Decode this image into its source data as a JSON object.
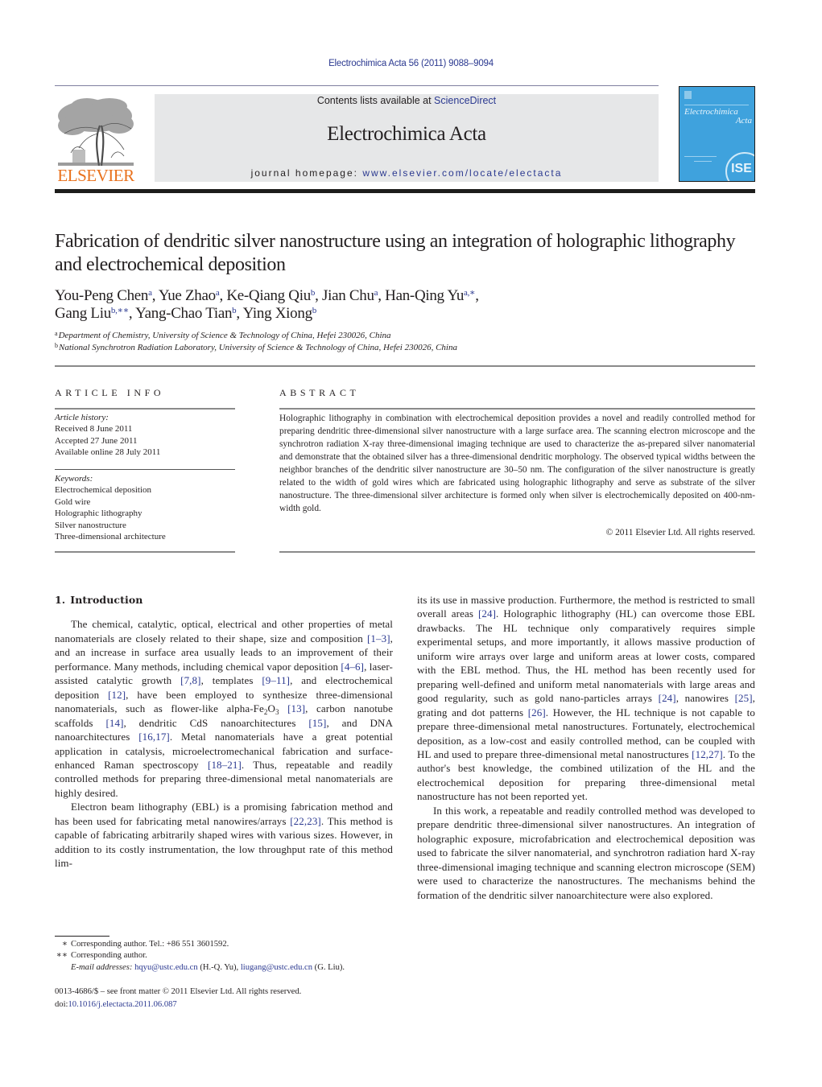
{
  "header": {
    "running_head": "Electrochimica Acta 56 (2011) 9088–9094",
    "contents_prefix": "Contents lists available at ",
    "contents_link": "ScienceDirect",
    "journal_name": "Electrochimica Acta",
    "homepage_prefix": "journal homepage: ",
    "homepage_url": "www.elsevier.com/locate/electacta",
    "publisher_logo_text": "ELSEVIER",
    "cover": {
      "title_line1": "Electrochimica",
      "title_line2": "Acta",
      "seal_text": "ISE",
      "background": "#3fa2dd"
    },
    "link_color": "#2b3990",
    "publisher_color": "#e9711c"
  },
  "article": {
    "title": "Fabrication of dendritic silver nanostructure using an integration of holographic lithography and electrochemical deposition",
    "authors_line1": [
      {
        "name": "You-Peng Chen",
        "sup": "a",
        "sep": ", "
      },
      {
        "name": "Yue Zhao",
        "sup": "a",
        "sep": ", "
      },
      {
        "name": "Ke-Qiang Qiu",
        "sup": "b",
        "sep": ", "
      },
      {
        "name": "Jian Chu",
        "sup": "a",
        "sep": ", "
      },
      {
        "name": "Han-Qing Yu",
        "sup": "a,∗",
        "sep": ","
      }
    ],
    "authors_line2": [
      {
        "name": "Gang Liu",
        "sup": "b,∗∗",
        "sep": ", "
      },
      {
        "name": "Yang-Chao Tian",
        "sup": "b",
        "sep": ", "
      },
      {
        "name": "Ying Xiong",
        "sup": "b",
        "sep": ""
      }
    ],
    "affiliations": [
      {
        "mark": "a",
        "text": "Department of Chemistry, University of Science & Technology of China, Hefei 230026, China"
      },
      {
        "mark": "b",
        "text": "National Synchrotron Radiation Laboratory, University of Science & Technology of China, Hefei 230026, China"
      }
    ]
  },
  "article_info": {
    "heading": "ARTICLE INFO",
    "history_label": "Article history:",
    "received": "Received 8 June 2011",
    "accepted": "Accepted 27 June 2011",
    "online": "Available online 28 July 2011",
    "keywords_label": "Keywords:",
    "keywords": [
      "Electrochemical deposition",
      "Gold wire",
      "Holographic lithography",
      "Silver nanostructure",
      "Three-dimensional architecture"
    ]
  },
  "abstract": {
    "heading": "ABSTRACT",
    "text": "Holographic lithography in combination with electrochemical deposition provides a novel and readily controlled method for preparing dendritic three-dimensional silver nanostructure with a large surface area. The scanning electron microscope and the synchrotron radiation X-ray three-dimensional imaging technique are used to characterize the as-prepared silver nanomaterial and demonstrate that the obtained silver has a three-dimensional dendritic morphology. The observed typical widths between the neighbor branches of the dendritic silver nanostructure are 30–50 nm. The configuration of the silver nanostructure is greatly related to the width of gold wires which are fabricated using holographic lithography and serve as substrate of the silver nanostructure. The three-dimensional silver architecture is formed only when silver is electrochemically deposited on 400-nm-width gold.",
    "copyright": "© 2011 Elsevier Ltd. All rights reserved."
  },
  "body": {
    "section1": {
      "number": "1.",
      "title": "Introduction"
    },
    "p1": [
      {
        "t": "The chemical, catalytic, optical, electrical and other properties of metal nanomaterials are closely related to their shape, size and composition "
      },
      {
        "ref": "[1–3]"
      },
      {
        "t": ", and an increase in surface area usually leads to an improvement of their performance. Many methods, including chemical vapor deposition "
      },
      {
        "ref": "[4–6]"
      },
      {
        "t": ", laser-assisted catalytic growth "
      },
      {
        "ref": "[7,8]"
      },
      {
        "t": ", templates "
      },
      {
        "ref": "[9–11]"
      },
      {
        "t": ", and electrochemical deposition "
      },
      {
        "ref": "[12]"
      },
      {
        "t": ", have been employed to synthesize three-dimensional nanomaterials, such as flower-like alpha-Fe"
      },
      {
        "sub": "2"
      },
      {
        "t": "O"
      },
      {
        "sub": "3"
      },
      {
        "t": " "
      },
      {
        "ref": "[13]"
      },
      {
        "t": ", carbon nanotube scaffolds "
      },
      {
        "ref": "[14]"
      },
      {
        "t": ", dendritic CdS nanoarchitectures "
      },
      {
        "ref": "[15]"
      },
      {
        "t": ", and DNA nanoarchitectures "
      },
      {
        "ref": "[16,17]"
      },
      {
        "t": ". Metal nanomaterials have a great potential application in catalysis, microelectromechanical fabrication and surface-enhanced Raman spectroscopy "
      },
      {
        "ref": "[18–21]"
      },
      {
        "t": ". Thus, repeatable and readily controlled methods for preparing three-dimensional metal nanomaterials are highly desired."
      }
    ],
    "p2": [
      {
        "t": "Electron beam lithography (EBL) is a promising fabrication method and has been used for fabricating metal nanowires/arrays "
      },
      {
        "ref": "[22,23]"
      },
      {
        "t": ". This method is capable of fabricating arbitrarily shaped wires with various sizes. However, in addition to its costly instrumentation, the low throughput rate of this method lim-"
      }
    ],
    "p2_cont": [
      {
        "t": "its its use in massive production. Furthermore, the method is restricted to small overall areas "
      },
      {
        "ref": "[24]"
      },
      {
        "t": ". Holographic lithography (HL) can overcome those EBL drawbacks. The HL technique only comparatively requires simple experimental setups, and more importantly, it allows massive production of uniform wire arrays over large and uniform areas at lower costs, compared with the EBL method. Thus, the HL method has been recently used for preparing well-defined and uniform metal nanomaterials with large areas and good regularity, such as gold nano-particles arrays "
      },
      {
        "ref": "[24]"
      },
      {
        "t": ", nanowires "
      },
      {
        "ref": "[25]"
      },
      {
        "t": ", grating and dot patterns "
      },
      {
        "ref": "[26]"
      },
      {
        "t": ". However, the HL technique is not capable to prepare three-dimensional metal nanostructures. Fortunately, electrochemical deposition, as a low-cost and easily controlled method, can be coupled with HL and used to prepare three-dimensional metal nanostructures "
      },
      {
        "ref": "[12,27]"
      },
      {
        "t": ". To the author's best knowledge, the combined utilization of the HL and the electrochemical deposition for preparing three-dimensional metal nanostructure has not been reported yet."
      }
    ],
    "p3": [
      {
        "t": "In this work, a repeatable and readily controlled method was developed to prepare dendritic three-dimensional silver nanostructures. An integration of holographic exposure, microfabrication and electrochemical deposition was used to fabricate the silver nanomaterial, and synchrotron radiation hard X-ray three-dimensional imaging technique and scanning electron microscope (SEM) were used to characterize the nanostructures. The mechanisms behind the formation of the dendritic silver nanoarchitecture were also explored."
      }
    ]
  },
  "footnotes": {
    "fn1_mark": "∗",
    "fn1_text": "Corresponding author. Tel.: +86 551 3601592.",
    "fn2_mark": "∗∗",
    "fn2_text": "Corresponding author.",
    "email_label": "E-mail addresses:",
    "email1": "hqyu@ustc.edu.cn",
    "email1_who": " (H.-Q. Yu), ",
    "email2": "liugang@ustc.edu.cn",
    "email2_who": " (G. Liu).",
    "issn_line": "0013-4686/$ – see front matter © 2011 Elsevier Ltd. All rights reserved.",
    "doi_prefix": "doi:",
    "doi": "10.1016/j.electacta.2011.06.087"
  }
}
